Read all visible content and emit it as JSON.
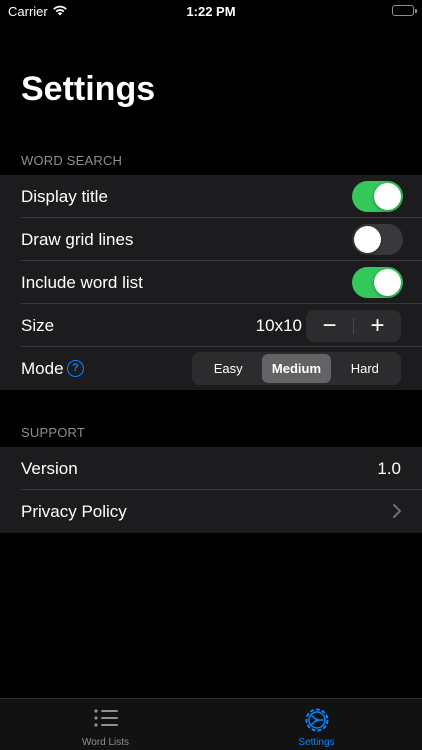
{
  "status_bar": {
    "carrier": "Carrier",
    "time": "1:22 PM"
  },
  "page": {
    "title": "Settings"
  },
  "word_search": {
    "header": "WORD SEARCH",
    "display_title": {
      "label": "Display title",
      "on": true
    },
    "draw_grid_lines": {
      "label": "Draw grid lines",
      "on": false
    },
    "include_word_list": {
      "label": "Include word list",
      "on": true
    },
    "size": {
      "label": "Size",
      "value": "10x10",
      "minus": "−",
      "plus": "+"
    },
    "mode": {
      "label": "Mode",
      "help": "?",
      "options": [
        "Easy",
        "Medium",
        "Hard"
      ],
      "selected": "Medium"
    }
  },
  "support": {
    "header": "SUPPORT",
    "version": {
      "label": "Version",
      "value": "1.0"
    },
    "privacy_policy": {
      "label": "Privacy Policy"
    }
  },
  "tab_bar": {
    "tabs": [
      {
        "label": "Word Lists",
        "icon": "list-icon",
        "active": false
      },
      {
        "label": "Settings",
        "icon": "gear-icon",
        "active": true
      }
    ]
  },
  "colors": {
    "accent": "#0a84ff",
    "toggle_on": "#34c759",
    "background": "#000000",
    "cell": "#1c1c1e"
  }
}
